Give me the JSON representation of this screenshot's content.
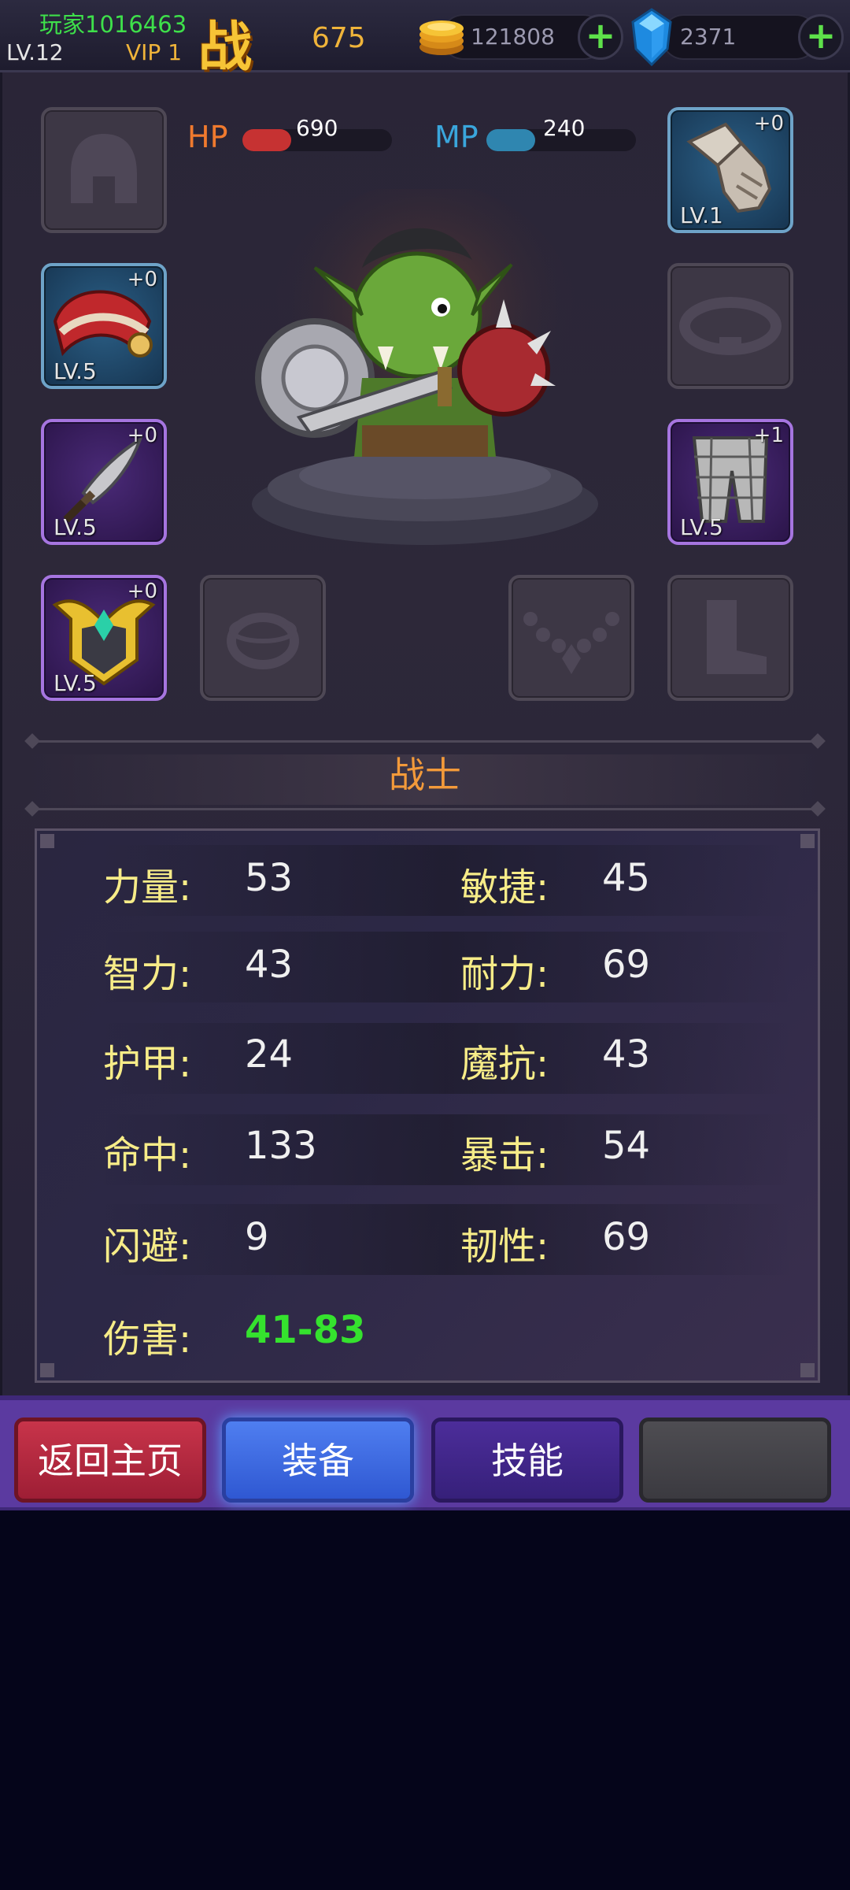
{
  "player": {
    "name": "玩家1016463",
    "level": "LV.12",
    "vip": "VIP 1",
    "power_glyph": "战",
    "power_value": "675"
  },
  "resources": {
    "gold": {
      "value": "121808",
      "icon": "gold-coin-icon",
      "add_icon": "plus-icon"
    },
    "gems": {
      "value": "2371",
      "icon": "blue-gem-icon",
      "add_icon": "plus-icon"
    }
  },
  "vitals": {
    "hp": {
      "label": "HP",
      "value": "690",
      "color": "#c63232"
    },
    "mp": {
      "label": "MP",
      "value": "240",
      "color": "#2f86b0"
    }
  },
  "equipment": {
    "helmet": {
      "icon": "helmet-icon",
      "empty": true
    },
    "gloves": {
      "icon": "gauntlet-icon",
      "level": "LV.1",
      "plus": "+0",
      "rarity": "blue"
    },
    "shoulder": {
      "icon": "pauldron-icon",
      "level": "LV.5",
      "plus": "+0",
      "rarity": "blue"
    },
    "belt": {
      "icon": "belt-icon",
      "empty": true
    },
    "weapon": {
      "icon": "sword-icon",
      "level": "LV.5",
      "plus": "+0",
      "rarity": "purple"
    },
    "pants": {
      "icon": "pants-icon",
      "level": "LV.5",
      "plus": "+1",
      "rarity": "purple"
    },
    "armor": {
      "icon": "chest-armor-icon",
      "level": "LV.5",
      "plus": "+0",
      "rarity": "purple"
    },
    "ring": {
      "icon": "ring-icon",
      "empty": true
    },
    "necklace": {
      "icon": "necklace-icon",
      "empty": true
    },
    "boots": {
      "icon": "boot-icon",
      "empty": true
    }
  },
  "hero": {
    "class_name": "战士",
    "portrait": "orc-warrior-figure"
  },
  "stats": {
    "strength": {
      "label": "力量:",
      "value": "53"
    },
    "agility": {
      "label": "敏捷:",
      "value": "45"
    },
    "intellect": {
      "label": "智力:",
      "value": "43"
    },
    "stamina": {
      "label": "耐力:",
      "value": "69"
    },
    "armor": {
      "label": "护甲:",
      "value": "24"
    },
    "magic_resist": {
      "label": "魔抗:",
      "value": "43"
    },
    "hit": {
      "label": "命中:",
      "value": "133"
    },
    "crit": {
      "label": "暴击:",
      "value": "54"
    },
    "dodge": {
      "label": "闪避:",
      "value": "9"
    },
    "toughness": {
      "label": "韧性:",
      "value": "69"
    },
    "damage": {
      "label": "伤害:",
      "value": "41-83",
      "color": "#35e22e"
    }
  },
  "nav": {
    "home": "返回主页",
    "equip": "装备",
    "skill": "技能",
    "empty": ""
  }
}
